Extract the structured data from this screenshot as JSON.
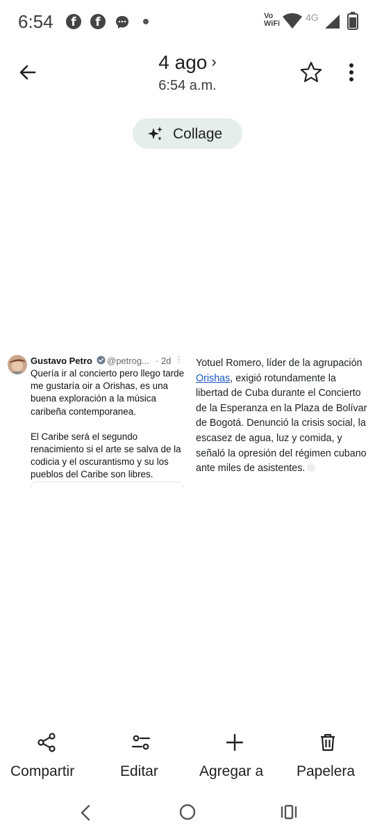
{
  "status_bar": {
    "time": "6:54",
    "vowifi_line1": "Vo",
    "vowifi_line2": "WiFi",
    "network": "4G",
    "icons": [
      "facebook-icon",
      "facebook-icon",
      "messenger-icon",
      "dot-icon",
      "wifi-icon",
      "signal-icon",
      "battery-icon"
    ]
  },
  "header": {
    "date": "4 ago",
    "time": "6:54 a.m.",
    "icons": [
      "back-arrow-icon",
      "chevron-right-icon",
      "star-icon",
      "more-vert-icon"
    ]
  },
  "collage": {
    "label": "Collage",
    "icon": "sparkle-icon"
  },
  "photo": {
    "tweet": {
      "name": "Gustavo Petro",
      "handle": "@petrog...",
      "time": "· 2d",
      "paragraph1": "Quería ir al concierto pero llego tarde me gustaría oir a Orishas, es una buena exploración a la música caribeña contemporanea.",
      "paragraph2": "El Caribe será el segundo renacimiento si el arte se salva de la codicia y el oscurantismo y su los pueblos del Caribe son libres."
    },
    "article": {
      "text_before": "Yotuel Romero, líder de la agrupación ",
      "link": "Orishas",
      "text_after": ", exigió rotundamente la libertad de Cuba durante el Concierto de la Esperanza en la Plaza de Bolívar de Bogotá. Denunció la crisis social, la escasez de agua, luz y comida, y señaló la opresión del régimen cubano ante miles de asistentes."
    }
  },
  "actions": {
    "share": "Compartir",
    "edit": "Editar",
    "add": "Agregar a",
    "trash": "Papelera"
  },
  "colors": {
    "chip_bg": "#e6eeec",
    "link": "#1a56c9",
    "verified": "#1d9bf0"
  }
}
